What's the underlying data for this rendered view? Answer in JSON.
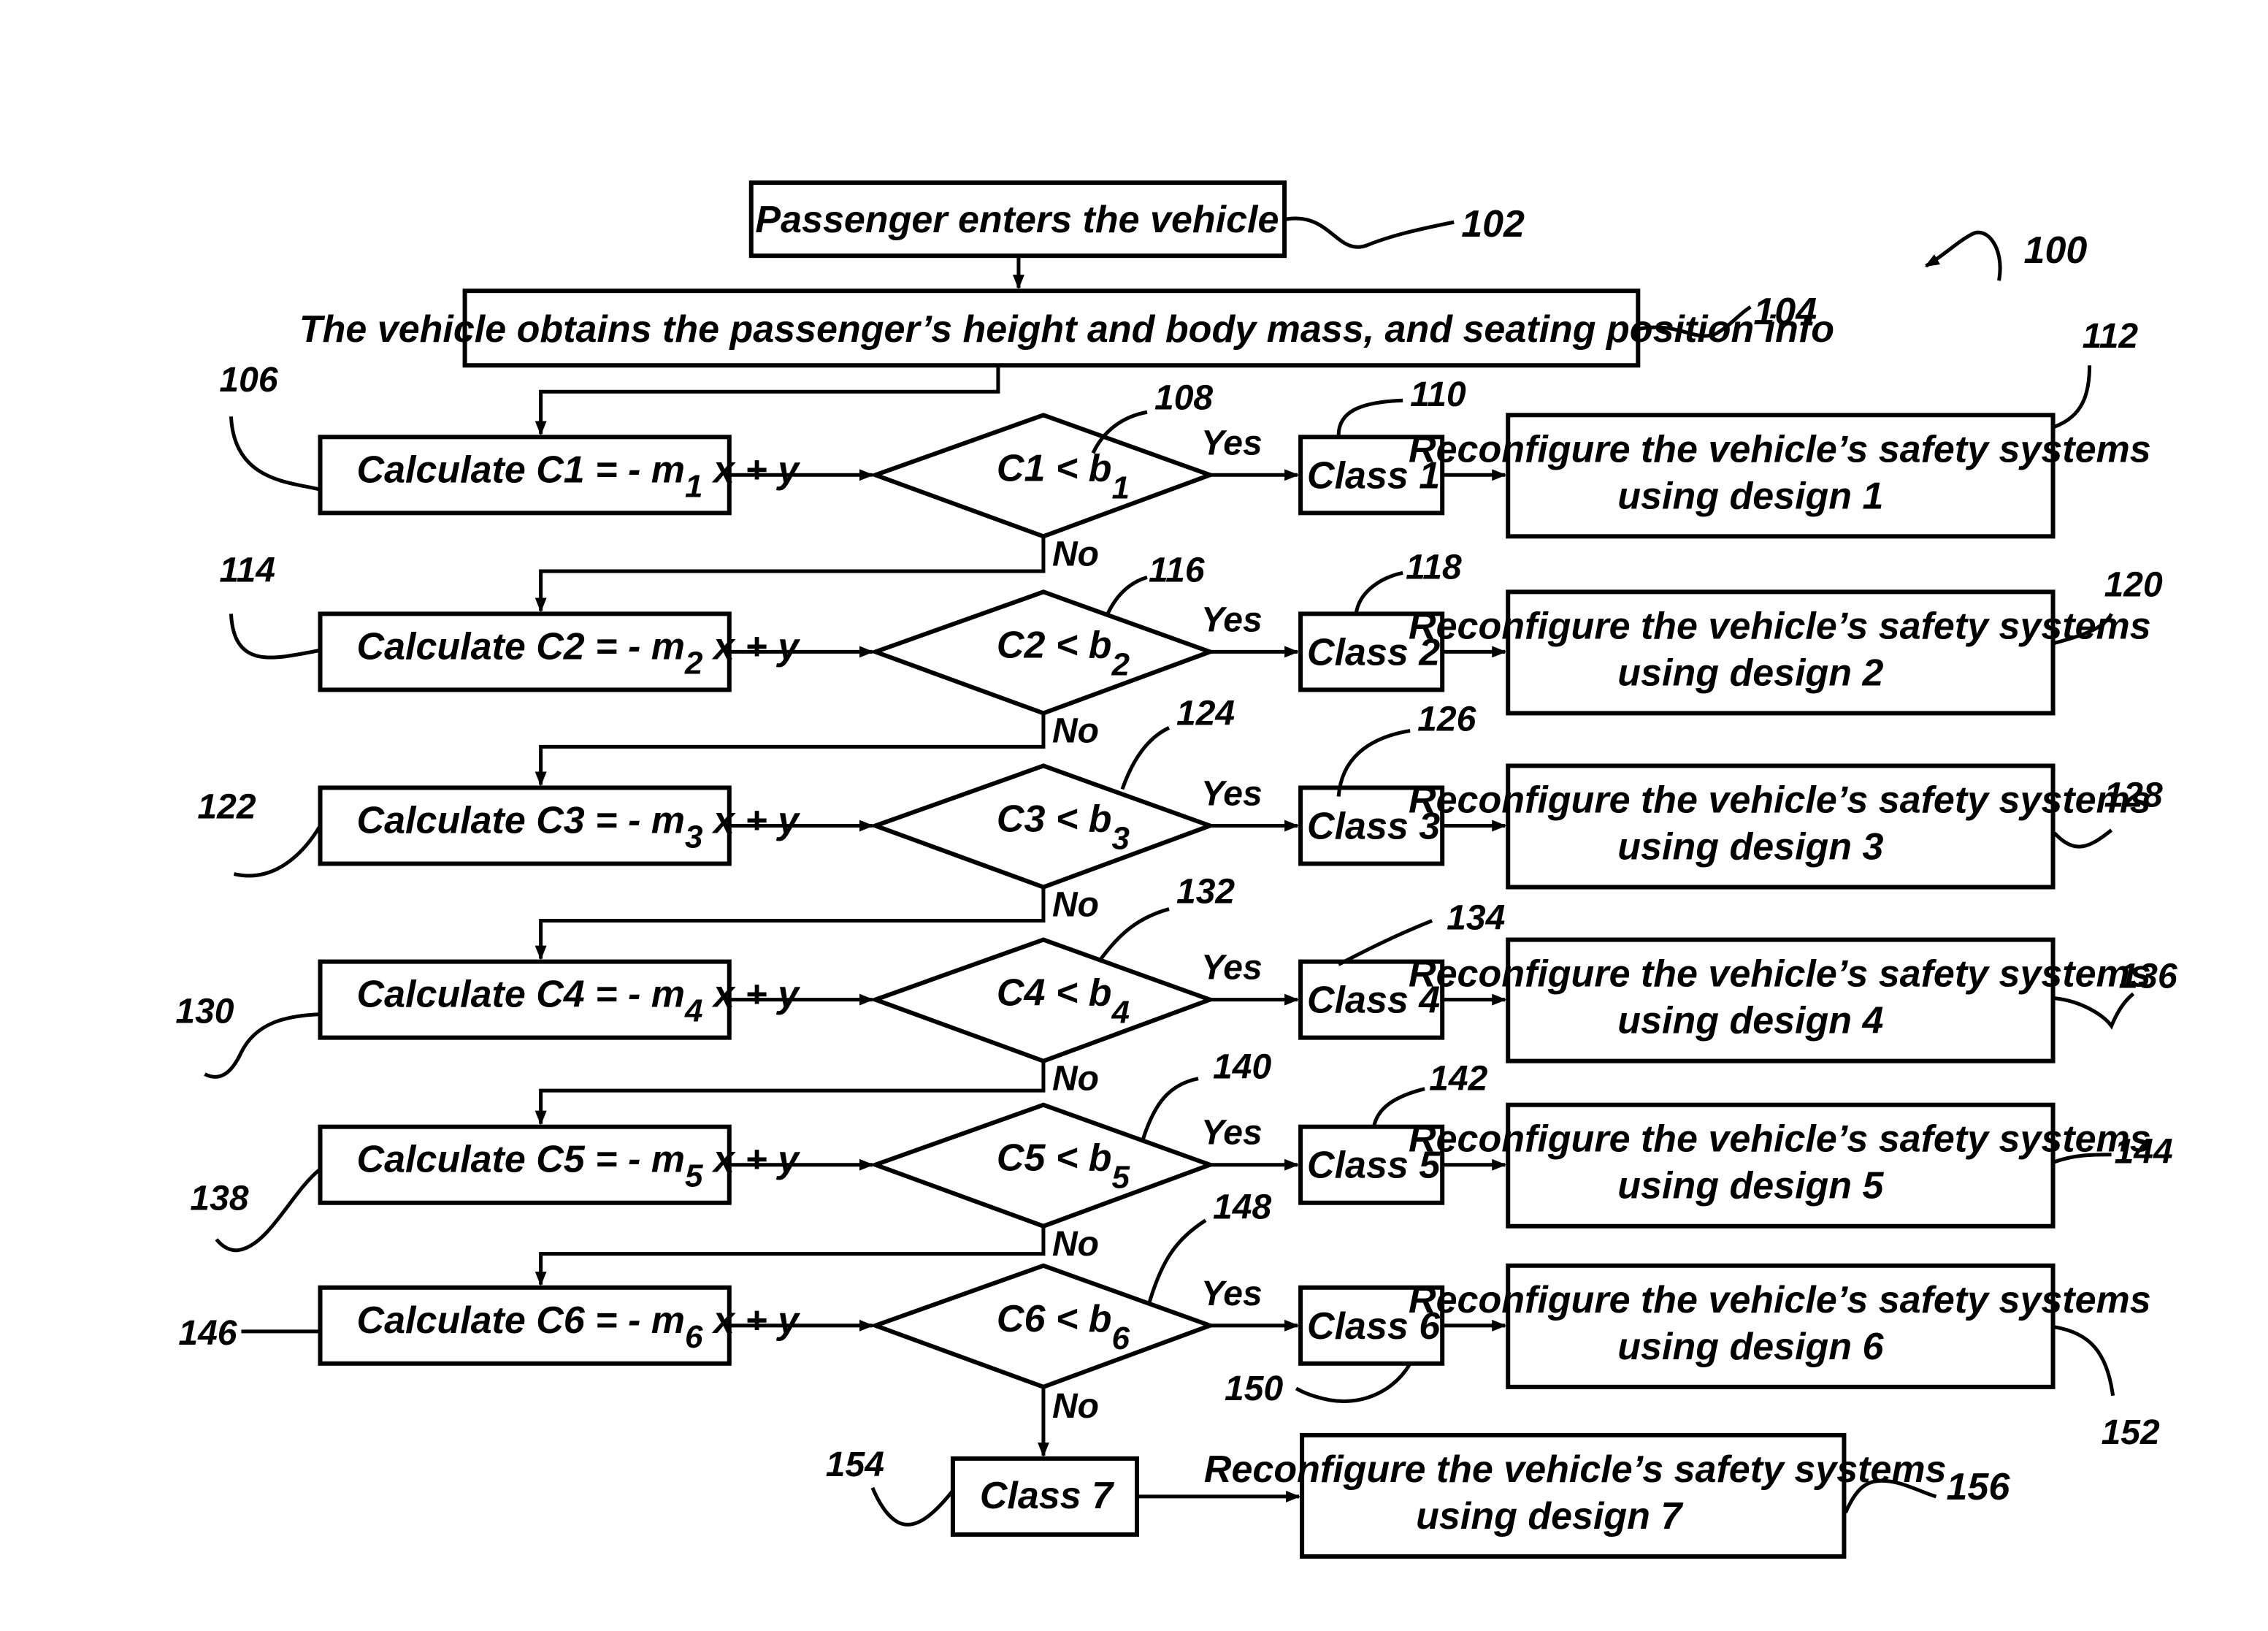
{
  "figure_label": "100",
  "start": {
    "text": "Passenger enters the vehicle",
    "ref": "102"
  },
  "obtain": {
    "text": "The vehicle obtains the passenger’s height and body mass, and seating position info",
    "ref": "104"
  },
  "yes_label": "Yes",
  "no_label": "No",
  "rows": [
    {
      "calc_prefix": "Calculate  C1  = - m",
      "sub": "1",
      "calc_suffix": " x + y",
      "calc_ref": "106",
      "cond": "C1 < b",
      "cond_sub": "1",
      "cond_ref": "108",
      "class": "Class 1",
      "class_ref": "110",
      "action1": "Reconfigure the vehicle’s safety systems",
      "action2": "using design 1",
      "action_ref": "112"
    },
    {
      "calc_prefix": "Calculate  C2  = - m",
      "sub": "2",
      "calc_suffix": " x + y",
      "calc_ref": "114",
      "cond": "C2 < b",
      "cond_sub": "2",
      "cond_ref": "116",
      "class": "Class 2",
      "class_ref": "118",
      "action1": "Reconfigure the vehicle’s safety systems",
      "action2": "using design 2",
      "action_ref": "120"
    },
    {
      "calc_prefix": "Calculate  C3  = -  m",
      "sub": "3",
      "calc_suffix": " x + y",
      "calc_ref": "122",
      "cond": "C3 < b",
      "cond_sub": "3",
      "cond_ref": "124",
      "class": "Class 3",
      "class_ref": "126",
      "action1": "Reconfigure the vehicle’s safety systems",
      "action2": "using design 3",
      "action_ref": "128"
    },
    {
      "calc_prefix": "Calculate  C4  = - m",
      "sub": "4",
      "calc_suffix": " x + y",
      "calc_ref": "130",
      "cond": "C4 < b",
      "cond_sub": "4",
      "cond_ref": "132",
      "class": "Class 4",
      "class_ref": "134",
      "action1": "Reconfigure the vehicle’s safety systems",
      "action2": "using design 4",
      "action_ref": "136"
    },
    {
      "calc_prefix": "Calculate  C5  = - m",
      "sub": "5",
      "calc_suffix": " x + y",
      "calc_ref": "138",
      "cond": "C5 < b",
      "cond_sub": "5",
      "cond_ref": "140",
      "class": "Class 5",
      "class_ref": "142",
      "action1": "Reconfigure the vehicle’s safety systems",
      "action2": "using design 5",
      "action_ref": "144"
    },
    {
      "calc_prefix": "Calculate  C6  = - m",
      "sub": "6",
      "calc_suffix": " x + y",
      "calc_ref": "146",
      "cond": "C6 < b",
      "cond_sub": "6",
      "cond_ref": "148",
      "class": "Class 6",
      "class_ref": "150",
      "action1": "Reconfigure the vehicle’s safety systems",
      "action2": "using design 6",
      "action_ref": "152"
    }
  ],
  "final": {
    "class": "Class 7",
    "class_ref": "154",
    "action1": "Reconfigure the vehicle’s safety systems",
    "action2": "using design 7",
    "action_ref": "156"
  }
}
